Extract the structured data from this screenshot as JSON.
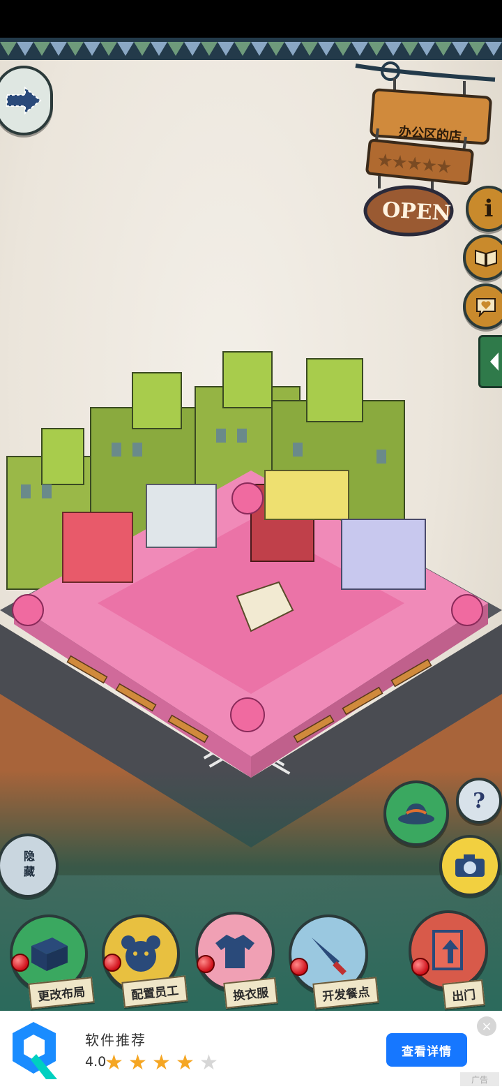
{
  "shop": {
    "name": "办公区的店",
    "status": "OPEN",
    "stars_filled": 0,
    "stars_total": 5
  },
  "side_buttons": {
    "info_icon": "info-icon",
    "book_icon": "book-icon",
    "heart_icon": "heart-chat-icon",
    "hide_label": "隐藏",
    "help_label": "?"
  },
  "toolbar": {
    "change_layout": "更改布局",
    "assign_staff": "配置员工",
    "change_clothes": "换衣服",
    "develop_menu": "开发餐点",
    "go_out": "出门"
  },
  "ad": {
    "title": "软件推荐",
    "rating": "4.0",
    "rating_value": 4,
    "button": "查看详情",
    "close": "×",
    "tag": "广告",
    "accent": "#1677ff"
  }
}
